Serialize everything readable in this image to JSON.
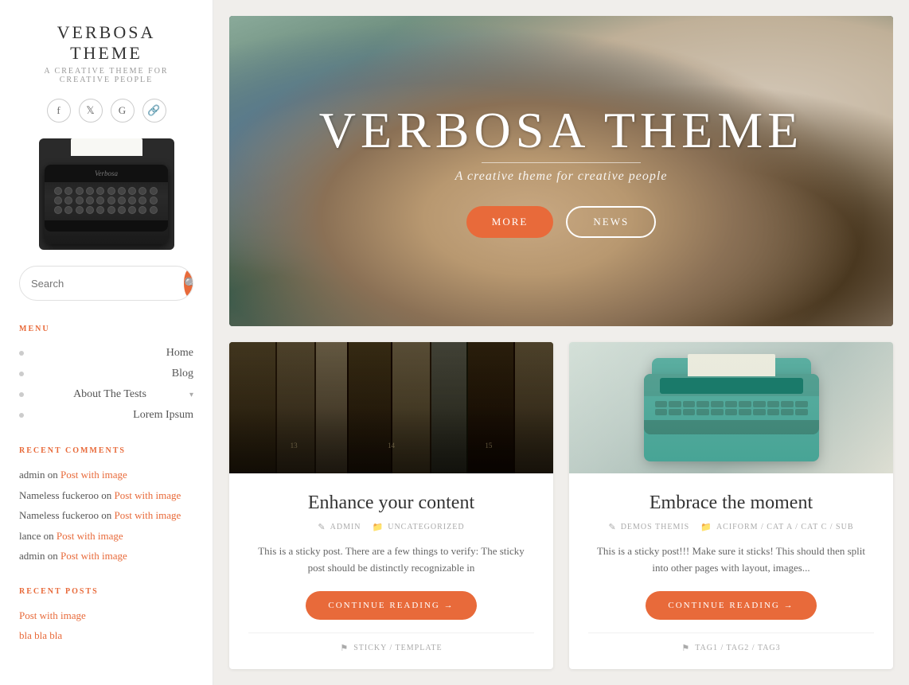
{
  "sidebar": {
    "logo": {
      "title": "VERBOSA THEME",
      "subtitle": "A CREATIVE THEME FOR CREATIVE PEOPLE"
    },
    "social": [
      {
        "name": "facebook",
        "icon": "f"
      },
      {
        "name": "twitter",
        "icon": "t"
      },
      {
        "name": "googleplus",
        "icon": "g+"
      },
      {
        "name": "link",
        "icon": "⌘"
      }
    ],
    "search": {
      "placeholder": "Search"
    },
    "menu_label": "MENU",
    "menu_items": [
      {
        "label": "Home",
        "has_arrow": false
      },
      {
        "label": "Blog",
        "has_arrow": false
      },
      {
        "label": "About The Tests",
        "has_arrow": true
      },
      {
        "label": "Lorem Ipsum",
        "has_arrow": false
      }
    ],
    "recent_comments_label": "RECENT COMMENTS",
    "recent_comments": [
      {
        "author": "admin",
        "link_text": "Post with image",
        "connector": "on"
      },
      {
        "author": "Nameless fuckeroo",
        "link_text": "Post with image",
        "connector": "on"
      },
      {
        "author": "Nameless fuckeroo",
        "link_text": "Post with image",
        "connector": "on"
      },
      {
        "author": "lance",
        "link_text": "Post with image",
        "connector": "on"
      },
      {
        "author": "admin",
        "link_text": "Post with image",
        "connector": "on"
      }
    ],
    "recent_posts_label": "RECENT POSTS",
    "recent_posts": [
      {
        "label": "Post with image"
      },
      {
        "label": "bla bla bla"
      }
    ]
  },
  "hero": {
    "title": "VERBOSA THEME",
    "subtitle": "A creative theme for creative people",
    "btn_more": "MORE",
    "btn_news": "NEWS"
  },
  "cards": [
    {
      "id": "card1",
      "title": "Enhance your content",
      "meta_author": "ADMIN",
      "meta_category": "UNCATEGORIZED",
      "excerpt": "This is a sticky post. There are a few things to verify: The sticky post should be distinctly recognizable in",
      "cta": "CONTINUE READING →",
      "tag_icon": "⚑",
      "tags": "STICKY / TEMPLATE"
    },
    {
      "id": "card2",
      "title": "Embrace the moment",
      "meta_author": "DEMOS THEMIS",
      "meta_category": "ACIFORM / CAT A / CAT C / SUB",
      "excerpt": "This is a sticky post!!! Make sure it sticks! This should then split into other pages with layout, images...",
      "cta": "CONTINUE READING →",
      "tag_icon": "⚑",
      "tags": "TAG1 / TAG2 / TAG3"
    }
  ],
  "icons": {
    "search": "🔍",
    "user": "✎",
    "tag": "🏷",
    "arrow_right": "→"
  }
}
